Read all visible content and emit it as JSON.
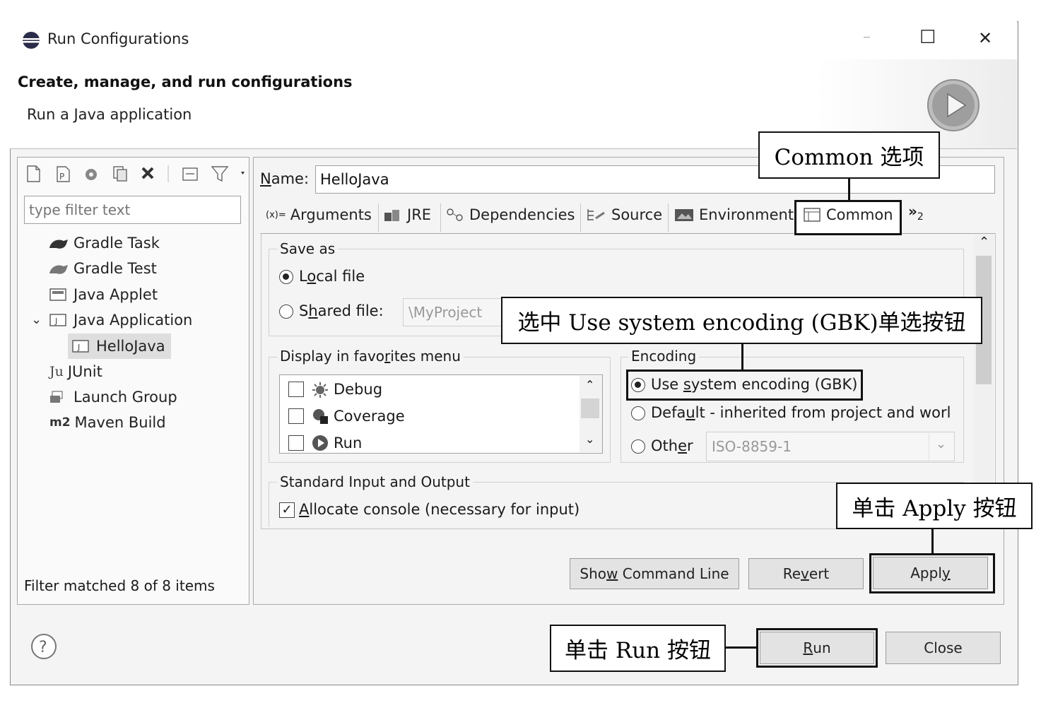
{
  "window": {
    "title": "Run Configurations",
    "minimize": "–",
    "maximize": "☐",
    "close": "✕"
  },
  "header": {
    "title": "Create, manage, and run configurations",
    "subtitle": "Run a Java application"
  },
  "left": {
    "filter_placeholder": "type filter text",
    "items": [
      {
        "label": "Gradle Task",
        "icon": "gradle-icon"
      },
      {
        "label": "Gradle Test",
        "icon": "gradle-icon"
      },
      {
        "label": "Java Applet",
        "icon": "java-applet-icon"
      },
      {
        "label": "Java Application",
        "icon": "java-app-icon"
      },
      {
        "label": "HelloJava",
        "icon": "java-app-icon"
      },
      {
        "label": "JUnit",
        "icon": "junit-icon"
      },
      {
        "label": "Launch Group",
        "icon": "launch-group-icon"
      },
      {
        "label": "Maven Build",
        "icon": "maven-icon"
      }
    ],
    "junit_prefix": "Ju",
    "maven_prefix": "m2",
    "status": "Filter matched 8 of 8 items"
  },
  "name_label": "Name:",
  "name_value": "HelloJava",
  "tabs": {
    "arguments": "Arguments",
    "arguments_prefix": "(x)=",
    "jre": "JRE",
    "dependencies": "Dependencies",
    "source": "Source",
    "environment": "Environment",
    "common": "Common",
    "more": "»",
    "more_count": "2"
  },
  "save_as": {
    "label": "Save as",
    "local": "Local file",
    "shared": "Shared file:",
    "shared_value": "\\MyProject"
  },
  "favorites": {
    "label": "Display in favorites menu",
    "items": [
      "Debug",
      "Coverage",
      "Run"
    ]
  },
  "encoding": {
    "label": "Encoding",
    "system": "Use system encoding (GBK)",
    "default": "Default - inherited from project and worl",
    "other": "Other",
    "other_value": "ISO-8859-1"
  },
  "std_io": {
    "label": "Standard Input and Output",
    "allocate": "Allocate console (necessary for input)"
  },
  "buttons": {
    "show_cmd": "Show Command Line",
    "revert": "Revert",
    "apply": "Apply",
    "run": "Run",
    "close": "Close"
  },
  "help": "?",
  "callouts": {
    "common": "Common 选项",
    "encoding": "选中 Use system encoding (GBK)单选按钮",
    "apply": "单击 Apply 按钮",
    "run": "单击 Run 按钮"
  }
}
